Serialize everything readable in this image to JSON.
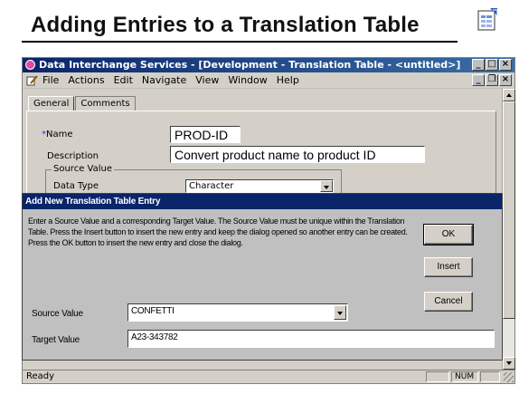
{
  "slide": {
    "title": "Adding Entries to a Translation Table"
  },
  "window": {
    "title": "Data Interchange Services - [Development - Translation Table - <untitled>]",
    "controls": [
      "_",
      "□",
      "×"
    ],
    "mdi_controls": [
      "_",
      "❐",
      "×"
    ]
  },
  "menubar": {
    "items": [
      {
        "label": "File"
      },
      {
        "label": "Actions"
      },
      {
        "label": "Edit"
      },
      {
        "label": "Navigate"
      },
      {
        "label": "View"
      },
      {
        "label": "Window"
      },
      {
        "label": "Help"
      }
    ]
  },
  "tabs": [
    {
      "label": "General",
      "active": true
    },
    {
      "label": "Comments",
      "active": false
    }
  ],
  "form": {
    "name_label": "*Name",
    "name_value": "PROD-ID",
    "description_label": "Description",
    "description_value": "Convert product name to product ID",
    "source_group_label": "Source Value",
    "data_type_label": "Data Type",
    "data_type_value": "Character"
  },
  "status": {
    "text": "Ready",
    "num": "NUM"
  },
  "dialog": {
    "title": "Add New Translation Table Entry",
    "instructions": "Enter a Source Value and a corresponding Target Value.  The Source Value must be unique within the Translation Table.  Press the Insert button to insert the new entry and keep the dialog opened so another entry can be created.  Press the OK button to insert the new entry and close the dialog.",
    "ok_label": "OK",
    "insert_label": "Insert",
    "cancel_label": "Cancel",
    "source_label": "Source Value",
    "source_value": "CONFETTI",
    "target_label": "Target Value",
    "target_value": "A23-343782"
  }
}
